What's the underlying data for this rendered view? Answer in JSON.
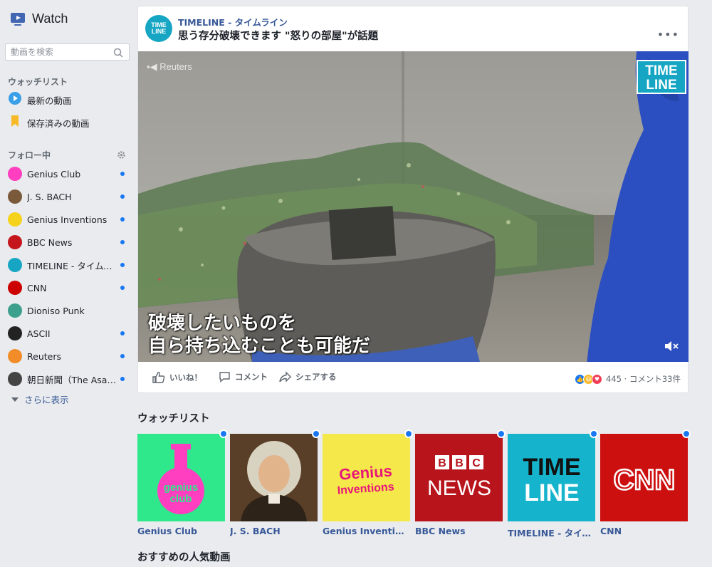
{
  "app": {
    "title": "Watch"
  },
  "search": {
    "placeholder": "動画を検索"
  },
  "watchlist_nav": {
    "title": "ウォッチリスト",
    "items": [
      {
        "label": "最新の動画",
        "icon": "play-circle-icon"
      },
      {
        "label": "保存済みの動画",
        "icon": "bookmark-icon"
      }
    ]
  },
  "following": {
    "title": "フォロー中",
    "items": [
      {
        "label": "Genius Club",
        "color": "#ff3fbf",
        "dot": true
      },
      {
        "label": "J. S. BACH",
        "color": "#7a5a3a",
        "dot": true
      },
      {
        "label": "Genius Inventions",
        "color": "#f5d21b",
        "dot": true
      },
      {
        "label": "BBC News",
        "color": "#c4161c",
        "dot": true
      },
      {
        "label": "TIMELINE - タイムライン",
        "color": "#16a6c4",
        "dot": true
      },
      {
        "label": "CNN",
        "color": "#cc0000",
        "dot": true
      },
      {
        "label": "Dioniso Punk",
        "color": "#3ca08c",
        "dot": false
      },
      {
        "label": "ASCII",
        "color": "#222222",
        "dot": true
      },
      {
        "label": "Reuters",
        "color": "#f28c28",
        "dot": true
      },
      {
        "label": "朝日新聞（The Asahi Shimbun）",
        "color": "#444444",
        "dot": true
      }
    ],
    "more_label": "さらに表示"
  },
  "post": {
    "page_name": "TIMELINE - タイムライン",
    "title": "思う存分破壊できます \"怒りの部屋\"が話題",
    "logo_text": [
      "TIME",
      "LINE"
    ],
    "video": {
      "watermark": "Reuters",
      "badge": [
        "TIME",
        "LINE"
      ],
      "caption_line1": "破壊したいものを",
      "caption_line2": "自ら持ち込むことも可能だ"
    },
    "actions": {
      "like": "いいね！",
      "comment": "コメント",
      "share": "シェアする"
    },
    "reactions_summary": "445 · コメント33件"
  },
  "watchlist": {
    "title": "ウォッチリスト",
    "tiles": [
      {
        "label": "Genius Club",
        "art": "genius-club",
        "bg": "#2ee88b",
        "dot": true
      },
      {
        "label": "J. S. BACH",
        "art": "bach-portrait",
        "bg": "#6b4a2e",
        "dot": true
      },
      {
        "label": "Genius Inventions",
        "art": "genius-inventions",
        "bg": "#f5e84a",
        "dot": true
      },
      {
        "label": "BBC News",
        "art": "bbc-news",
        "bg": "#b8141b",
        "dot": true
      },
      {
        "label": "TIMELINE - タイムライン",
        "art": "timeline",
        "bg": "#16b3cc",
        "dot": true
      },
      {
        "label": "CNN",
        "art": "cnn",
        "bg": "#cc1010",
        "dot": true
      }
    ],
    "art_text": {
      "genius_club": [
        "genius",
        "club"
      ],
      "genius_inventions": [
        "Genius",
        "Inventions"
      ],
      "bbc": [
        "B",
        "B",
        "C",
        "NEWS"
      ],
      "timeline": [
        "TIME",
        "LINE"
      ],
      "cnn": "CNN"
    }
  },
  "recommended": {
    "title": "おすすめの人気動画"
  }
}
